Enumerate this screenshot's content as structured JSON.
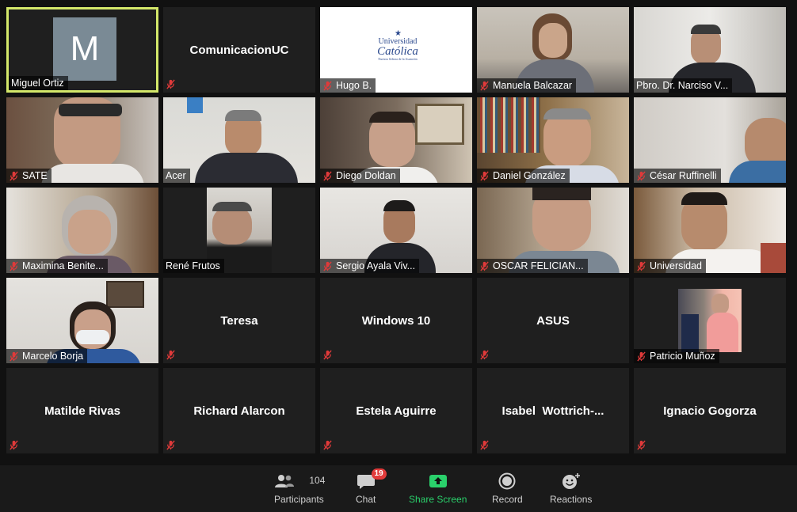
{
  "participants": [
    {
      "name": "Miguel Ortiz",
      "kind": "avatar",
      "initial": "M",
      "muted": false,
      "active": true
    },
    {
      "name": "ComunicacionUC",
      "kind": "name-only",
      "muted": true
    },
    {
      "name": "Hugo B.",
      "kind": "logo",
      "muted": true,
      "logo_line1": "Universidad",
      "logo_line2": "Católica",
      "logo_line3": "Nuestra Señora de la Asunción"
    },
    {
      "name": "Manuela Balcazar",
      "kind": "video",
      "muted": true
    },
    {
      "name": "Pbro. Dr. Narciso V...",
      "kind": "video",
      "muted": false
    },
    {
      "name": "SATE",
      "kind": "video",
      "muted": true
    },
    {
      "name": "Acer",
      "kind": "video",
      "muted": false
    },
    {
      "name": "Diego Doldan",
      "kind": "video",
      "muted": true
    },
    {
      "name": "Daniel González",
      "kind": "video",
      "muted": true
    },
    {
      "name": "César Ruffinelli",
      "kind": "video",
      "muted": true
    },
    {
      "name": "Maximina Benite...",
      "kind": "video",
      "muted": true
    },
    {
      "name": "René Frutos",
      "kind": "video",
      "muted": false
    },
    {
      "name": "Sergio Ayala Viv...",
      "kind": "video",
      "muted": true
    },
    {
      "name": "OSCAR FELICIAN...",
      "kind": "video",
      "muted": true
    },
    {
      "name": "Universidad",
      "kind": "video",
      "muted": true
    },
    {
      "name": "Marcelo Borja",
      "kind": "video",
      "muted": true
    },
    {
      "name": "Teresa",
      "kind": "name-only",
      "muted": true
    },
    {
      "name": "Windows 10",
      "kind": "name-only",
      "muted": true
    },
    {
      "name": "ASUS",
      "kind": "name-only",
      "muted": true
    },
    {
      "name": "Patricio Muñoz",
      "kind": "video",
      "muted": true
    },
    {
      "name": "Matilde Rivas",
      "kind": "name-only",
      "muted": true
    },
    {
      "name": "Richard Alarcon",
      "kind": "name-only",
      "muted": true
    },
    {
      "name": "Estela Aguirre",
      "kind": "name-only",
      "muted": true
    },
    {
      "name": "Isabel  Wottrich-...",
      "kind": "name-only",
      "muted": true
    },
    {
      "name": "Ignacio Gogorza",
      "kind": "name-only",
      "muted": true
    }
  ],
  "toolbar": {
    "participants_label": "Participants",
    "participants_count": "104",
    "chat_label": "Chat",
    "chat_badge": "19",
    "share_label": "Share Screen",
    "record_label": "Record",
    "reactions_label": "Reactions"
  },
  "colors": {
    "background": "#111111",
    "tile": "#1f1f1f",
    "active_border": "#d4e86a",
    "share_green": "#2ad06b",
    "muted_red": "#e03a3a",
    "badge_red": "#e23b3b"
  }
}
